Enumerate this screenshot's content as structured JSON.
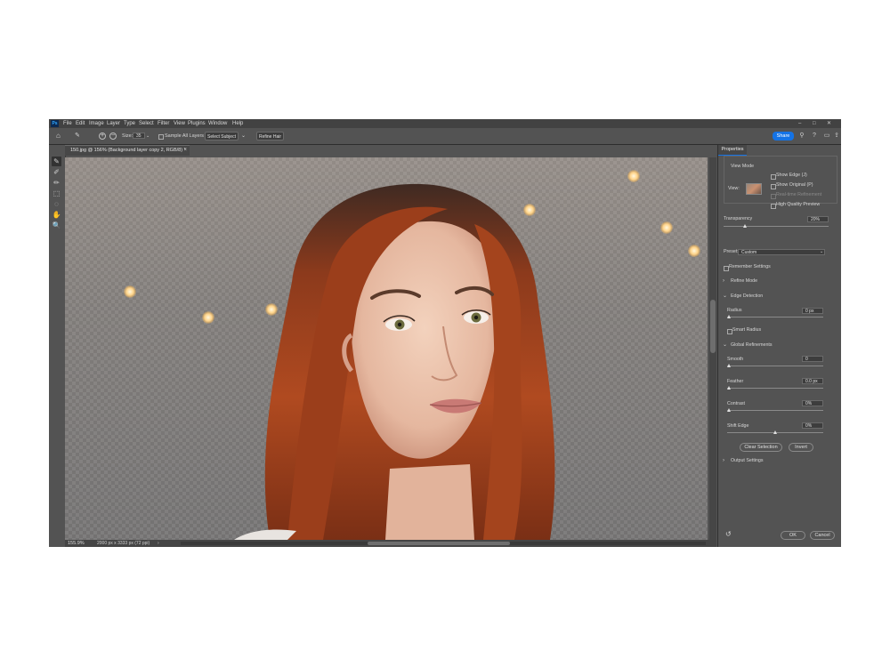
{
  "app": {
    "logo": "Ps",
    "menu": [
      "File",
      "Edit",
      "Image",
      "Layer",
      "Type",
      "Select",
      "Filter",
      "View",
      "Plugins",
      "Window",
      "Help"
    ],
    "window_controls": [
      "–",
      "□",
      "✕"
    ]
  },
  "options": {
    "size_label": "Size:",
    "size_value": "35",
    "sample_all_layers": "Sample All Layers",
    "select_subject": "Select Subject",
    "refine_hair": "Refine Hair",
    "share": "Share"
  },
  "document": {
    "tab_title": "150.jpg @ 156% (Background layer copy 2, RGB/8) *",
    "tab_close": "×",
    "zoom": "155.9%",
    "dimensions": "2000 px x 3333 px (72 ppi)",
    "status_arrow": "›"
  },
  "properties": {
    "tab": "Properties",
    "view_mode_label": "View Mode",
    "view_label": "View:",
    "show_edge": "Show Edge (J)",
    "show_original": "Show Original (P)",
    "realtime_refinement": "Real-time Refinement",
    "high_quality_preview": "High Quality Preview",
    "transparency_label": "Transparency",
    "transparency_value": "20%",
    "transparency_level": 0.2,
    "preset_label": "Preset:",
    "preset_value": "Custom",
    "remember_settings": "Remember Settings",
    "refine_mode": "Refine Mode",
    "edge_detection": "Edge Detection",
    "radius_label": "Radius",
    "radius_value": "0 px",
    "smart_radius": "Smart Radius",
    "global_refinements": "Global Refinements",
    "smooth_label": "Smooth",
    "smooth_value": "0",
    "feather_label": "Feather",
    "feather_value": "0.0 px",
    "contrast_label": "Contrast",
    "contrast_value": "0%",
    "shift_edge_label": "Shift Edge",
    "shift_edge_value": "0%",
    "clear_selection": "Clear Selection",
    "invert": "Invert",
    "output_settings": "Output Settings",
    "ok": "OK",
    "cancel": "Cancel"
  },
  "colors": {
    "accent": "#1473e6",
    "panel": "#535353",
    "hair": "#a4421e",
    "skin": "#e9c1a8"
  },
  "icons": [
    "home-icon",
    "brush-icon",
    "add-to-selection-icon",
    "subtract-from-selection-icon",
    "search-icon",
    "help-icon",
    "workspace-icon",
    "share-icon",
    "quick-selection-tool-icon",
    "refine-edge-brush-icon",
    "brush-tool-icon",
    "object-selection-icon",
    "lasso-icon",
    "hand-icon",
    "zoom-icon",
    "reset-icon"
  ]
}
